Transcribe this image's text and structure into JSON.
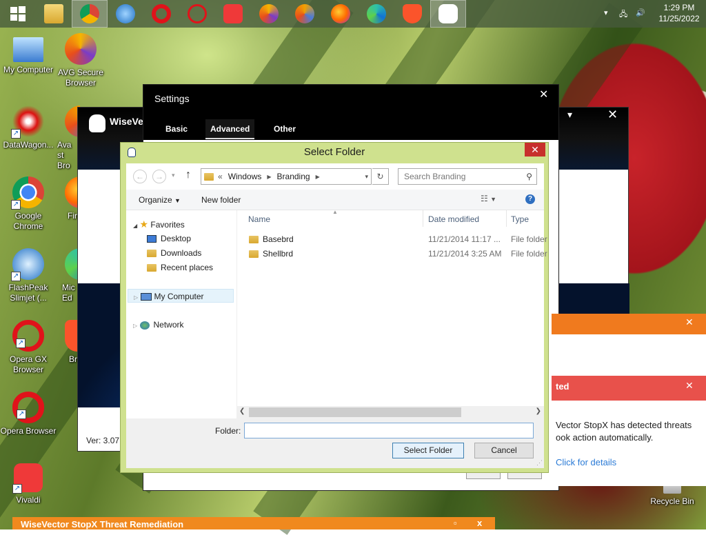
{
  "taskbar": {
    "clock_time": "1:29 PM",
    "clock_date": "11/25/2022",
    "apps": [
      "windows-start",
      "file-explorer",
      "chrome",
      "slimjet",
      "opera-gx",
      "opera",
      "vivaldi",
      "avg-browser",
      "avast-browser",
      "firefox",
      "edge",
      "brave",
      "wisevector"
    ]
  },
  "desktop_icons": [
    {
      "label": "My Computer",
      "icon": "computer-icon"
    },
    {
      "label": "AVG Secure Browser",
      "icon": "avg-browser-icon"
    },
    {
      "label": "DataWagon...",
      "icon": "datawagon-icon"
    },
    {
      "label": "Avast Bro",
      "icon": "avast-browser-icon"
    },
    {
      "label": "Google Chrome",
      "icon": "chrome-icon"
    },
    {
      "label": "Fir",
      "icon": "firefox-icon"
    },
    {
      "label": "FlashPeak Slimjet (...",
      "icon": "slimjet-icon"
    },
    {
      "label": "Mic Ed",
      "icon": "edge-icon"
    },
    {
      "label": "Opera GX Browser",
      "icon": "opera-gx-icon"
    },
    {
      "label": "Br",
      "icon": "brave-icon"
    },
    {
      "label": "Opera Browser",
      "icon": "opera-icon"
    },
    {
      "label": "Vivaldi",
      "icon": "vivaldi-icon"
    },
    {
      "label": "Recycle Bin",
      "icon": "recycle-bin-icon"
    }
  ],
  "wisevector": {
    "title": "WiseVec",
    "version": "Ver: 3.07"
  },
  "settings": {
    "title": "Settings",
    "tabs": [
      "Basic",
      "Advanced",
      "Other"
    ],
    "active_tab": "Advanced"
  },
  "alerts": {
    "detected_title": "ted",
    "message_line1": "Vector StopX has detected threats",
    "message_line2": "ook action automatically.",
    "details_link": "Click for details"
  },
  "bottom_window": {
    "title": "WiseVector StopX Threat Remediation"
  },
  "dialog": {
    "title": "Select Folder",
    "address": {
      "prefix": "«",
      "crumbs": [
        "Windows",
        "Branding"
      ]
    },
    "search_placeholder": "Search Branding",
    "organize": "Organize",
    "new_folder": "New folder",
    "nav": {
      "favorites": "Favorites",
      "desktop": "Desktop",
      "downloads": "Downloads",
      "recent": "Recent places",
      "computer": "My Computer",
      "network": "Network"
    },
    "columns": {
      "name": "Name",
      "date": "Date modified",
      "type": "Type"
    },
    "rows": [
      {
        "name": "Basebrd",
        "date": "11/21/2014 11:17 ...",
        "type": "File folder"
      },
      {
        "name": "Shellbrd",
        "date": "11/21/2014 3:25 AM",
        "type": "File folder"
      }
    ],
    "folder_label": "Folder:",
    "folder_value": "",
    "select_button": "Select Folder",
    "cancel_button": "Cancel"
  }
}
